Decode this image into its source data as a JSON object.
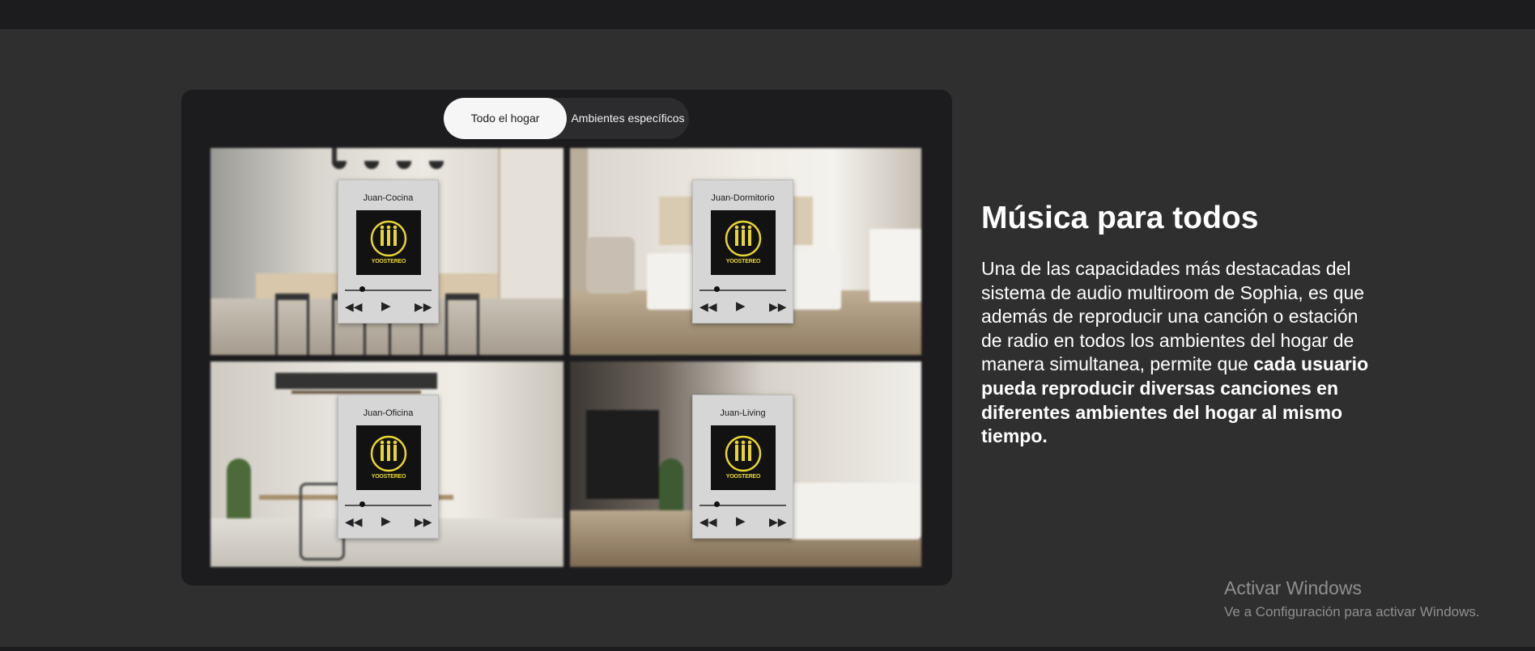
{
  "toggle": {
    "active": "Todo el hogar",
    "inactive": "Ambientes específicos"
  },
  "players": [
    {
      "zone": "Juan-Cocina",
      "logo": "YOOSTEREO",
      "progress": 0.2
    },
    {
      "zone": "Juan-Dormitorio",
      "logo": "YOOSTEREO",
      "progress": 0.2
    },
    {
      "zone": "Juan-Oficina",
      "logo": "YOOSTEREO",
      "progress": 0.2
    },
    {
      "zone": "Juan-Living",
      "logo": "YOOSTEREO",
      "progress": 0.2
    }
  ],
  "controls": {
    "rewind": "◀◀",
    "play": "▶",
    "forward": "▶▶"
  },
  "content": {
    "heading": "Música para todos",
    "paragraph_plain": "Una de las capacidades más destacadas del sistema de audio multiroom de Sophia, es que además de reproducir una canción o estación de radio en todos los ambientes del hogar de manera simultanea, permite que ",
    "paragraph_bold": "cada usuario pueda reproducir diversas canciones en diferentes ambientes del hogar al mismo tiempo",
    "paragraph_end": "."
  },
  "watermark": {
    "title": "Activar Windows",
    "subtitle": "Ve a Configuración para activar Windows."
  },
  "colors": {
    "background": "#2f2f30",
    "panel": "#1c1c1e",
    "logo_yellow": "#e8d534"
  }
}
